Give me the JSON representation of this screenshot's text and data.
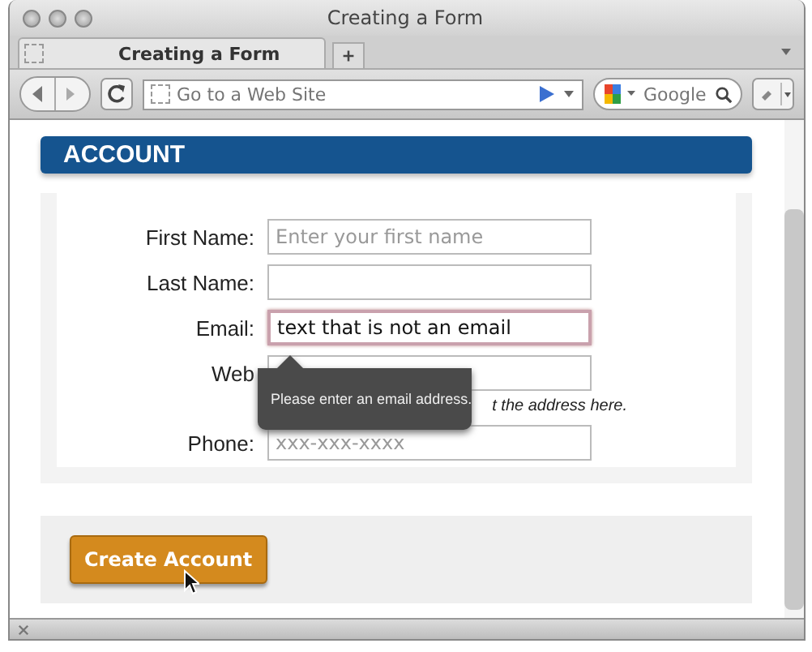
{
  "window": {
    "title": "Creating a Form"
  },
  "tabs": [
    {
      "label": "Creating a Form",
      "selected": true
    }
  ],
  "toolbar": {
    "address": {
      "placeholder": "Go to a Web Site"
    },
    "search": {
      "placeholder": "Google"
    }
  },
  "section": {
    "title": "ACCOUNT"
  },
  "fields": [
    {
      "label": "First Name:",
      "placeholder": "Enter your first name",
      "invalid": false
    },
    {
      "label": "Last Name:",
      "invalid": false
    },
    {
      "label": "Email:",
      "value": "text that is not an email",
      "invalid": true
    },
    {
      "label": "Web",
      "invalid": false,
      "hint": "t the address here."
    },
    {
      "label": "Phone:",
      "placeholder": "xxx-xxx-xxxx",
      "invalid": false
    }
  ],
  "tooltip": {
    "text": "Please enter an email address."
  },
  "button": {
    "label": "Create Account"
  }
}
